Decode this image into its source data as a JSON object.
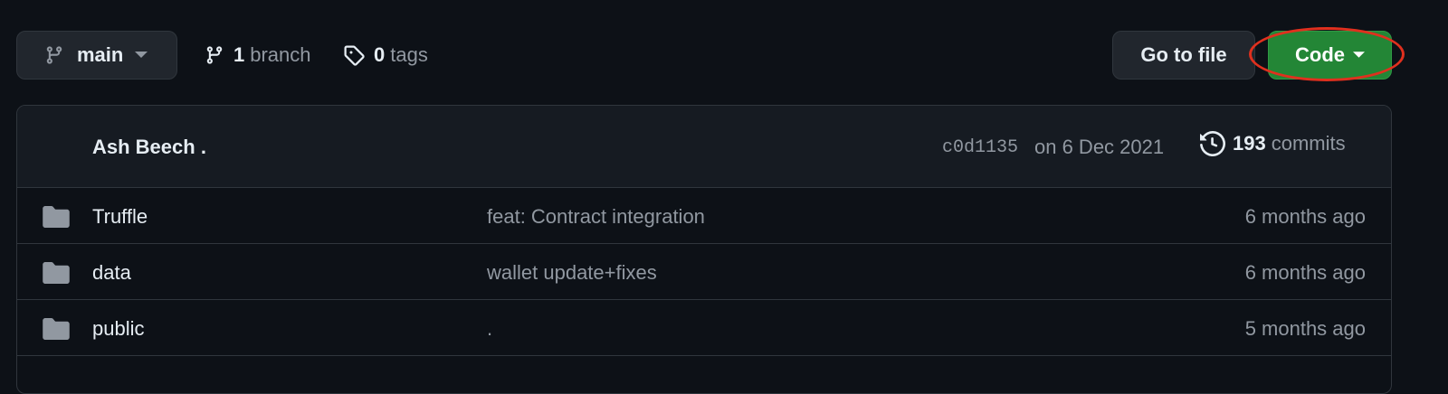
{
  "branch_selector": {
    "label": "main",
    "icon": "git-branch-icon"
  },
  "branches": {
    "count": "1",
    "label": "branch"
  },
  "tags": {
    "count": "0",
    "label": "tags"
  },
  "go_to_file": {
    "label": "Go to file"
  },
  "code_button": {
    "label": "Code"
  },
  "latest_commit": {
    "author": "Ash Beech .",
    "sha": "c0d1135",
    "date": "on 6 Dec 2021",
    "commit_count": "193",
    "commit_label": "commits"
  },
  "files": [
    {
      "name": "Truffle",
      "message": "feat: Contract integration",
      "age": "6 months ago",
      "icon": "folder-icon"
    },
    {
      "name": "data",
      "message": "wallet update+fixes",
      "age": "6 months ago",
      "icon": "folder-icon"
    },
    {
      "name": "public",
      "message": ".",
      "age": "5 months ago",
      "icon": "folder-icon"
    }
  ],
  "colors": {
    "background": "#0d1117",
    "code_button": "#238636",
    "highlight_ring": "#e0301e"
  }
}
